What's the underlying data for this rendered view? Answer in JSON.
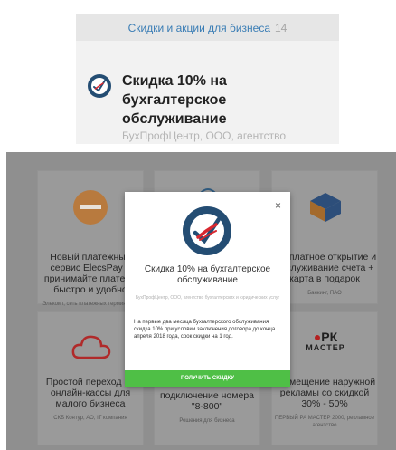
{
  "widget": {
    "header_label": "Скидки и акции для бизнеса",
    "header_count": "14",
    "offer_title": "Скидка 10% на бухгалтерское обслуживание",
    "offer_subtitle": "БухПрофЦентр, ООО, агентство"
  },
  "cards": [
    {
      "title": "Новый платежный сервис ElecsPay – принимайте платежи быстро и удобно",
      "subtitle": "Элекомт, сеть платежных терминалов",
      "icon": "elecspay-logo-icon"
    },
    {
      "title": "",
      "subtitle": "",
      "icon": "wireless-icon"
    },
    {
      "title": "Бесплатное открытие и обслуживание счета + карта в подарок",
      "subtitle": "Банкинг, ПАО",
      "icon": "cube-logo-icon"
    },
    {
      "title": "Простой переход на онлайн-кассы для малого бизнеса",
      "subtitle": "СКБ Контур, АО, IT компания",
      "icon": "cloud-icon"
    },
    {
      "title": "подключение номера \"8-800\"",
      "subtitle": "Решения для бизнеса",
      "icon": ""
    },
    {
      "title": "Размещение наружной рекламы со скидкой 30% - 50%",
      "subtitle": "ПЕРВЫЙ РА МАСТЕР 2000, рекламное агентство",
      "icon": "rk-master-logo-icon",
      "logo_text_top": "РК",
      "logo_text_bottom": "МАСТЕР"
    }
  ],
  "modal": {
    "close_label": "×",
    "title": "Скидка 10% на бухгалтерское обслуживание",
    "subtitle": "БухПрофЦентр, ООО, агентство бухгалтерских и юридических услуг",
    "description": "На первые два месяца бухгалтерского обслуживания скидка 10% при условии заключения договора до конца апреля 2018 года, срок скидки на 1 год.",
    "button_label": "ПОЛУЧИТЬ СКИДКУ"
  },
  "colors": {
    "accent_blue": "#3a7db5",
    "logo_navy": "#244d73",
    "logo_red": "#d8272f",
    "button_green": "#4fbf46",
    "overlay": "#8f8f8f"
  }
}
